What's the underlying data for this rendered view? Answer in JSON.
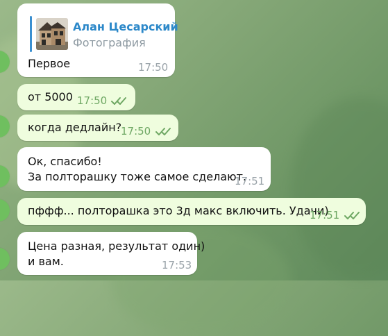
{
  "chat": {
    "messages": [
      {
        "direction": "incoming",
        "reply": {
          "author": "Алан Цесарский",
          "type": "Фотография"
        },
        "text": "Первое",
        "time": "17:50"
      },
      {
        "direction": "outgoing",
        "text": "от 5000",
        "time": "17:50",
        "status_icon": "double-check-icon"
      },
      {
        "direction": "outgoing",
        "text": "когда дедлайн?",
        "time": "17:50",
        "status_icon": "double-check-icon"
      },
      {
        "direction": "incoming",
        "lines": [
          "Ок, спасибо!",
          "За полторашку тоже самое сделают."
        ],
        "time": "17:51"
      },
      {
        "direction": "outgoing",
        "text": "пффф...  полторашка это 3д макс включить. Удачи)",
        "time": "17:51",
        "status_icon": "double-check-icon"
      },
      {
        "direction": "incoming",
        "lines": [
          "Цена разная, результат один)",
          "и вам."
        ],
        "time": "17:53"
      }
    ]
  },
  "colors": {
    "incoming_bubble": "#ffffff",
    "outgoing_bubble": "#effdde",
    "reply_accent": "#3a8fd0",
    "reply_name": "#2c88c9",
    "outgoing_time": "#6ea763",
    "incoming_time": "#9aa3a9",
    "avatar_edge": "#6fbf5f"
  }
}
